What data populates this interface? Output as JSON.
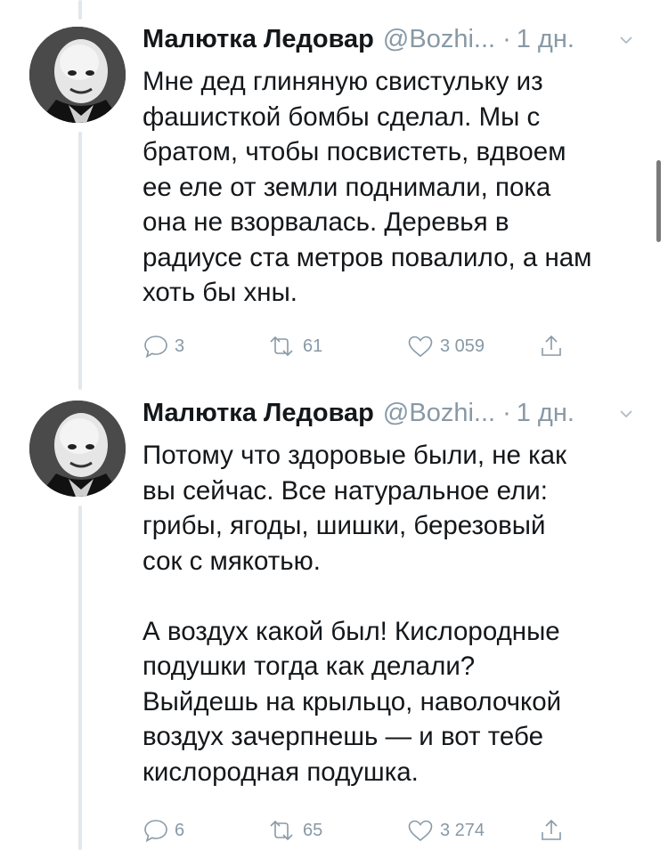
{
  "tweets": [
    {
      "author": {
        "name": "Малютка Ледовар",
        "handle": "@Bozhi...",
        "avatar_icon": "avatar-bald-man-icon"
      },
      "separator": "·",
      "time": "1 дн.",
      "text": "Мне дед глиняную свистульку из\nфашисткой бомбы сделал. Мы с\nбратом, чтобы посвистеть, вдвоем\nее еле от земли поднимали, пока\nона не взорвалась. Деревья в\nрадиусе ста метров повалило, а нам\nхоть бы хны.",
      "stats": {
        "replies": "3",
        "retweets": "61",
        "likes": "3 059"
      }
    },
    {
      "author": {
        "name": "Малютка Ледовар",
        "handle": "@Bozhi...",
        "avatar_icon": "avatar-bald-man-icon"
      },
      "separator": "·",
      "time": "1 дн.",
      "text": "Потому что здоровые были, не как\nвы сейчас. Все натуральное ели:\nгрибы, ягоды, шишки, березовый\nсок с мякотью.\n\nА воздух какой был! Кислородные\nподушки тогда как делали?\nВыйдешь на крыльцо, наволочкой\nвоздух зачерпнешь — и вот тебе\nкислородная подушка.",
      "stats": {
        "replies": "6",
        "retweets": "65",
        "likes": "3 274"
      }
    }
  ],
  "icons": {
    "reply": "reply-icon",
    "retweet": "retweet-icon",
    "like": "heart-icon",
    "share": "share-icon",
    "menu": "chevron-down-icon"
  },
  "colors": {
    "text": "#14171a",
    "secondary": "#8899a6",
    "thread_line": "#e1e8ed"
  }
}
